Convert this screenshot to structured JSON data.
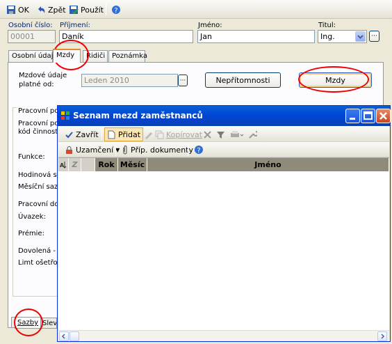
{
  "toolbar": {
    "ok_label": "OK",
    "back_label": "Zpět",
    "apply_label": "Použít"
  },
  "form": {
    "osobni_cislo_label": "Osobní číslo:",
    "osobni_cislo_value": "00001",
    "prijmeni_label": "Příjmení:",
    "prijmeni_value": "Daník",
    "jmeno_label": "Jméno:",
    "jmeno_value": "Jan",
    "titul_label": "Titul:",
    "titul_value": "Ing."
  },
  "tabs": [
    "Osobní údaje",
    "Mzdy",
    "Řidiči",
    "Poznámka"
  ],
  "mzdy_tab": {
    "platne_label_1": "Mzdové údaje",
    "platne_label_2": "platné od:",
    "platne_value": "Leden 2010",
    "nepritomnosti_button": "Nepřítomnosti",
    "mzdy_button": "Mzdy"
  },
  "side_labels": {
    "group_title": "Pracovní po",
    "line1": "Pracovní po",
    "line2": "kód činnosti",
    "funkce": "Funkce:",
    "hodinova": "Hodinová sa",
    "mesicni": "Měsíční sazb",
    "pracovni_doba": "Pracovní dob",
    "uvazek": "Úvazek:",
    "premie": "Prémie:",
    "dovolena": "Dovolená - n",
    "limit": "Limt ošetřov"
  },
  "bottom_tabs": [
    "Sazby",
    "Slev"
  ],
  "popup": {
    "title": "Seznam mezd zaměstnanců",
    "toolbar": {
      "close_label": "Zavřít",
      "add_label": "Přidat",
      "copy_label": "Kopírovat",
      "lock_label": "Uzamčení",
      "docs_label": "Příp. dokumenty"
    },
    "grid_headers": [
      "Z",
      "Rok",
      "Měsíc",
      "Jméno"
    ]
  },
  "colors": {
    "titlebar": "#0a5fd8",
    "highlight_circle": "#e00000",
    "tab_accent": "#e68b2c"
  }
}
